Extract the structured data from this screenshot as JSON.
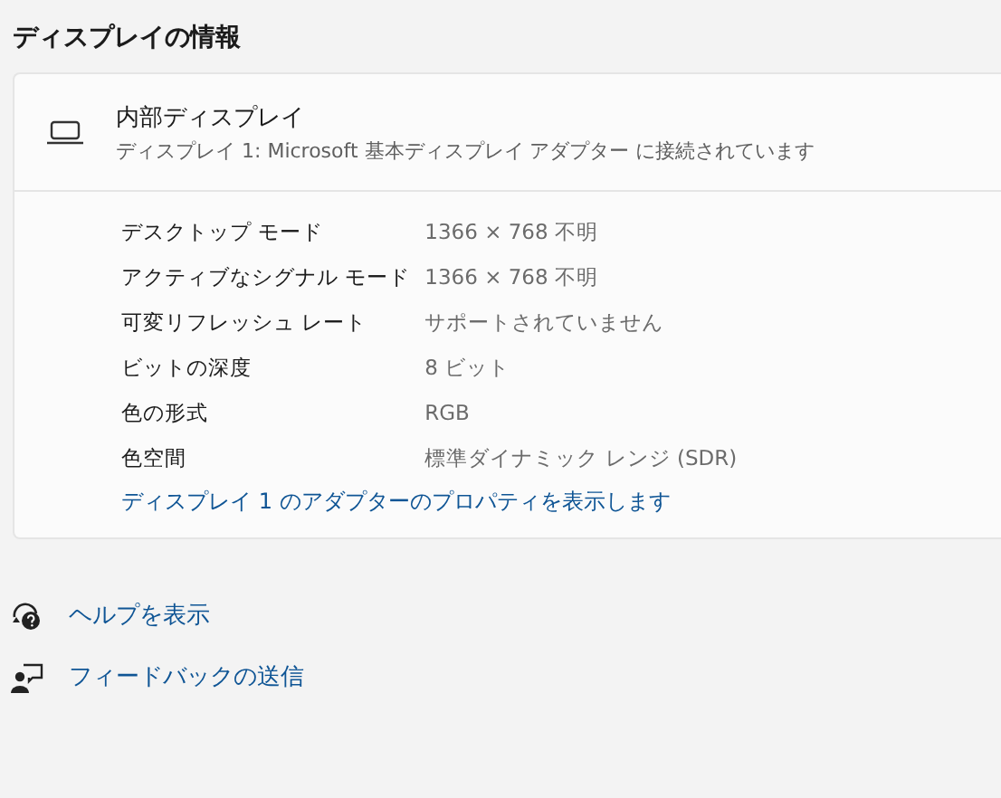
{
  "section_title": "ディスプレイの情報",
  "display": {
    "name": "内部ディスプレイ",
    "subtitle": "ディスプレイ 1: Microsoft 基本ディスプレイ アダプター に接続されています"
  },
  "properties": [
    {
      "label": "デスクトップ モード",
      "value": "1366 × 768 不明"
    },
    {
      "label": "アクティブなシグナル モード",
      "value": "1366 × 768 不明"
    },
    {
      "label": "可変リフレッシュ レート",
      "value": "サポートされていません"
    },
    {
      "label": "ビットの深度",
      "value": "8 ビット"
    },
    {
      "label": "色の形式",
      "value": "RGB"
    },
    {
      "label": "色空間",
      "value": "標準ダイナミック レンジ (SDR)"
    }
  ],
  "adapter_link": "ディスプレイ 1 のアダプターのプロパティを表示します",
  "help_links": [
    {
      "kind": "help",
      "label": "ヘルプを表示"
    },
    {
      "kind": "feedback",
      "label": "フィードバックの送信"
    }
  ]
}
